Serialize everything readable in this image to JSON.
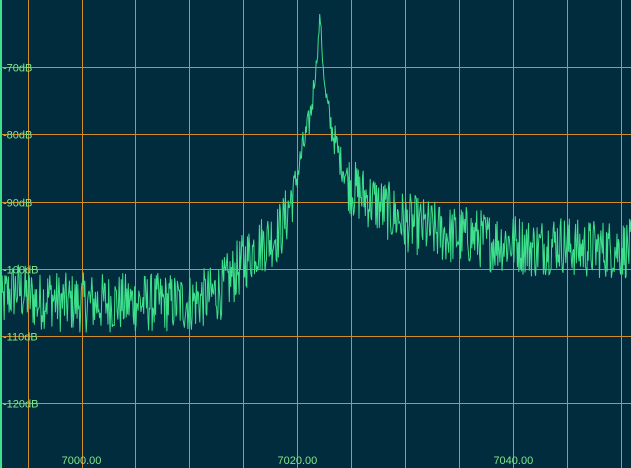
{
  "chart_data": {
    "type": "line",
    "title": "",
    "xlabel": "",
    "ylabel": "",
    "grid": true,
    "colors": {
      "background": "#002c3e",
      "grid": "#d38a28",
      "trace": "#3ee08c",
      "labels": "#7fe88a"
    },
    "xlim": [
      6992.45,
      7050.9
    ],
    "ylim": [
      -129.6,
      -60.0
    ],
    "x_ticks": [
      {
        "value": 7000,
        "label": "7000.00"
      },
      {
        "value": 7020,
        "label": "7020.00"
      },
      {
        "value": 7040,
        "label": "7040.00"
      }
    ],
    "x_grid_values": [
      6995,
      7000,
      7005,
      7010,
      7015,
      7020,
      7025,
      7030,
      7035,
      7040,
      7045,
      7050
    ],
    "y_ticks": [
      {
        "value": -70,
        "label": "-70dB"
      },
      {
        "value": -80,
        "label": "-80dB"
      },
      {
        "value": -90,
        "label": "-90dB"
      },
      {
        "value": -100,
        "label": "-100dB"
      },
      {
        "value": -110,
        "label": "-110dB"
      },
      {
        "value": -120,
        "label": "-120dB"
      }
    ],
    "series": [
      {
        "x": [
          6992.5,
          6993,
          6994,
          6995,
          6996,
          6997,
          6998,
          7000,
          7002,
          7004,
          7006,
          7008,
          7010,
          7012,
          7013,
          7014,
          7015,
          7015.5,
          7016,
          7017,
          7018,
          7018.5,
          7019,
          7019.5,
          7020,
          7020.5,
          7021,
          7021.3,
          7021.6,
          7021.9,
          7022.1,
          7022.3,
          7022.6,
          7023,
          7023.5,
          7024,
          7024.5,
          7025,
          7026,
          7027,
          7028,
          7029,
          7030,
          7032,
          7034,
          7036,
          7038,
          7040,
          7042,
          7044,
          7046,
          7048,
          7050,
          7050.9
        ],
        "y": [
          -106,
          -104,
          -103,
          -104,
          -105,
          -104,
          -105,
          -105,
          -105,
          -105,
          -105,
          -105,
          -105,
          -104,
          -103,
          -101,
          -99,
          -98,
          -97,
          -96,
          -95,
          -94,
          -92,
          -89,
          -86,
          -82,
          -79,
          -76,
          -72,
          -67,
          -62,
          -68,
          -74,
          -78,
          -81,
          -84,
          -86,
          -88,
          -89,
          -90,
          -91,
          -92,
          -93,
          -94,
          -95,
          -95,
          -96,
          -96,
          -97,
          -96,
          -97,
          -97,
          -97,
          -97
        ]
      }
    ]
  }
}
